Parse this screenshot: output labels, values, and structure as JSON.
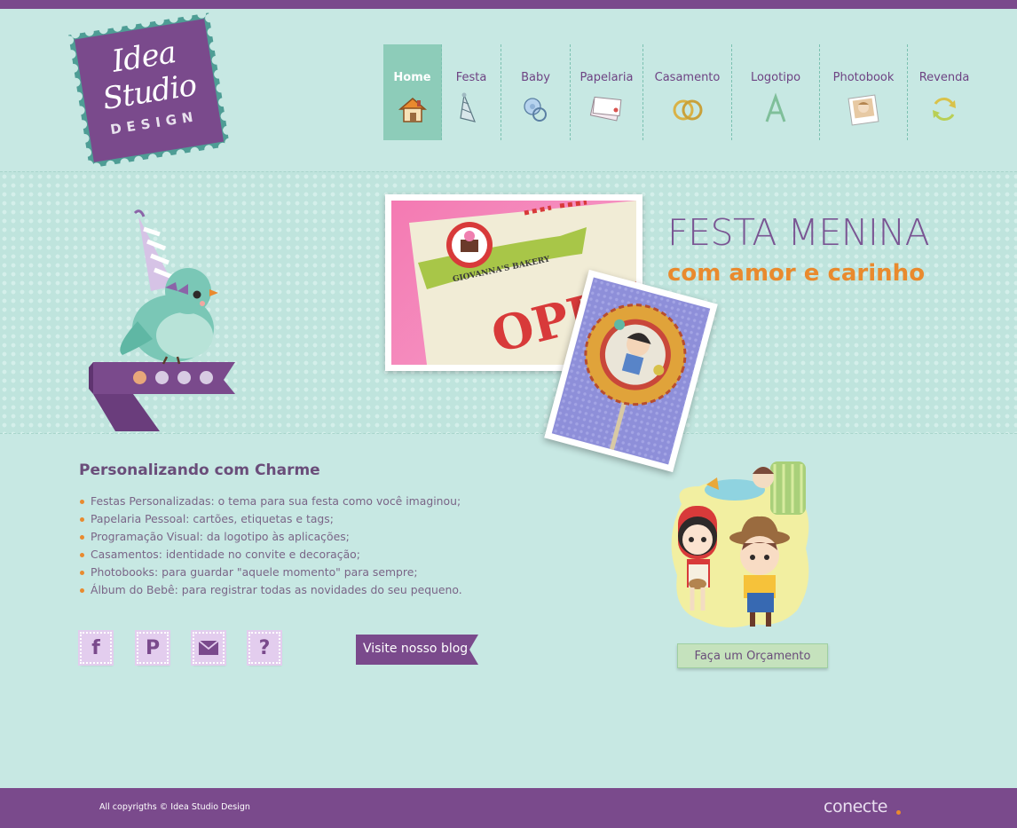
{
  "brand": {
    "logo_line1": "Idea",
    "logo_line2": "Studio",
    "logo_line3": "DESIGN",
    "primary_color": "#7a4a8c",
    "accent_color": "#e98a2e",
    "background_color": "#c7e8e3"
  },
  "nav": {
    "items": [
      {
        "label": "Home",
        "icon": "house-icon",
        "active": true
      },
      {
        "label": "Festa",
        "icon": "party-hat-icon",
        "active": false
      },
      {
        "label": "Baby",
        "icon": "pacifier-icon",
        "active": false
      },
      {
        "label": "Papelaria",
        "icon": "stationery-cards-icon",
        "active": false
      },
      {
        "label": "Casamento",
        "icon": "wedding-rings-icon",
        "active": false
      },
      {
        "label": "Logotipo",
        "icon": "letter-a-icon",
        "active": false
      },
      {
        "label": "Photobook",
        "icon": "photo-icon",
        "active": false
      },
      {
        "label": "Revenda",
        "icon": "recycle-arrows-icon",
        "active": false
      }
    ]
  },
  "hero": {
    "title": "FESTA MENINA",
    "subtitle": "com amor e carinho",
    "photo_main_text": "OPEN!",
    "photo_main_banner": "GIOVANNA'S BAKERY",
    "slider": {
      "total": 4,
      "active": 1
    }
  },
  "content": {
    "section_title": "Personalizando com Charme",
    "features": [
      "Festas Personalizadas: o tema para sua festa como você imaginou;",
      "Papelaria Pessoal: cartões, etiquetas e tags;",
      "Programação Visual: da logotipo às aplicações;",
      "Casamentos: identidade no convite e decoração;",
      "Photobooks: para guardar \"aquele momento\" para sempre;",
      "Álbum do Bebê: para registrar todas as novidades do seu pequeno."
    ]
  },
  "social": {
    "facebook_glyph": "f",
    "pinterest_glyph": "P",
    "help_glyph": "?"
  },
  "blog_button": {
    "label": "Visite nosso blog"
  },
  "quote_button": {
    "label": "Faça um Orçamento"
  },
  "footer": {
    "copyright": "All copyrigths © Idea Studio Design",
    "credit": "conecte"
  }
}
